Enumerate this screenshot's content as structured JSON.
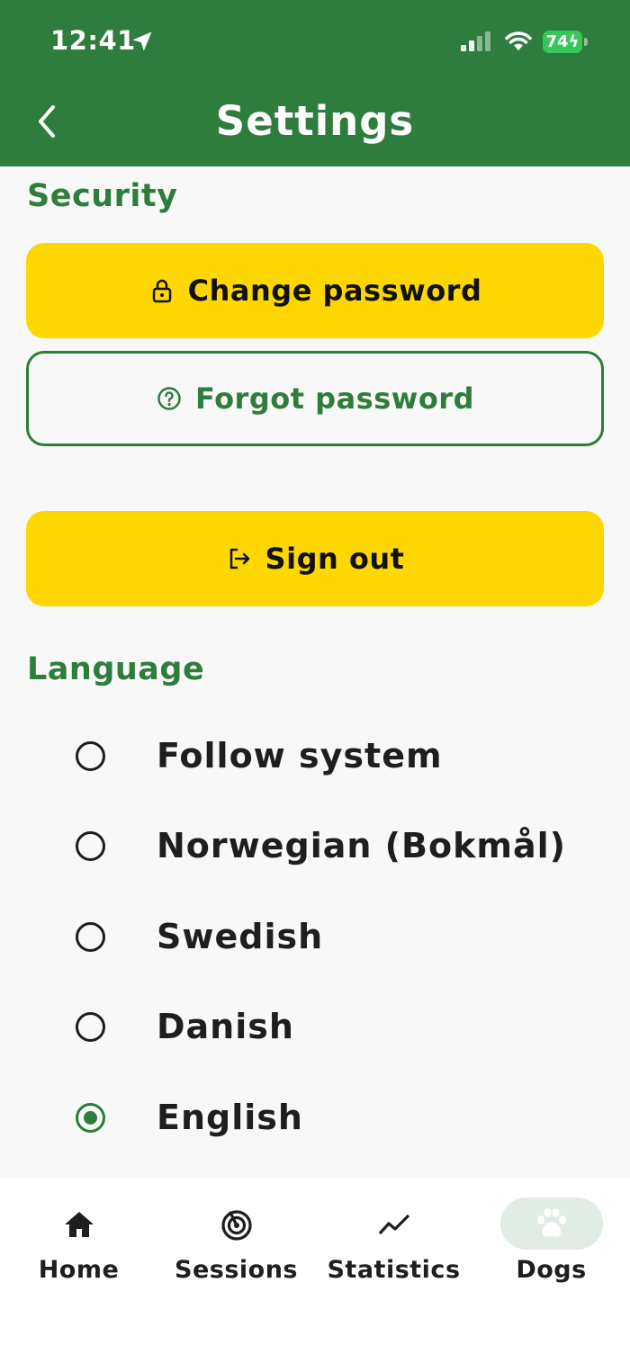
{
  "status_bar": {
    "time": "12:41",
    "battery": "74"
  },
  "header": {
    "title": "Settings"
  },
  "security": {
    "heading": "Security",
    "change_password": "Change password",
    "forgot_password": "Forgot password",
    "sign_out": "Sign out"
  },
  "language": {
    "heading": "Language",
    "options": [
      {
        "label": "Follow system",
        "selected": false
      },
      {
        "label": "Norwegian (Bokmål)",
        "selected": false
      },
      {
        "label": "Swedish",
        "selected": false
      },
      {
        "label": "Danish",
        "selected": false
      },
      {
        "label": "English",
        "selected": true
      }
    ]
  },
  "tabbar": {
    "tabs": [
      {
        "label": "Home",
        "icon": "home-icon",
        "active": false
      },
      {
        "label": "Sessions",
        "icon": "radar-icon",
        "active": false
      },
      {
        "label": "Statistics",
        "icon": "trend-icon",
        "active": false
      },
      {
        "label": "Dogs",
        "icon": "paw-icon",
        "active": true
      }
    ]
  },
  "colors": {
    "primary_green": "#2e7d3c",
    "accent_yellow": "#fed700",
    "background": "#f8f8f8",
    "active_tab_pill": "#e0ece4"
  }
}
